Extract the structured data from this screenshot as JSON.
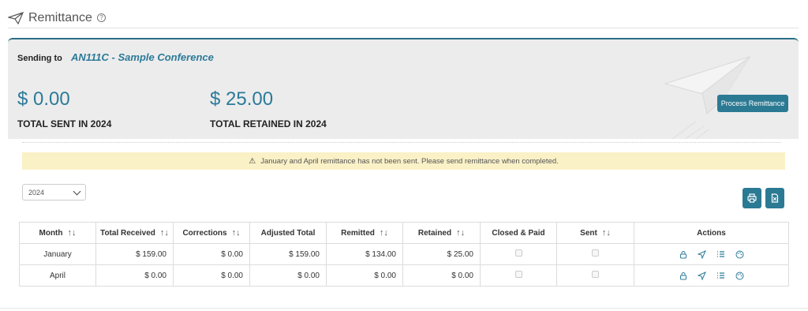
{
  "header": {
    "title": "Remittance",
    "help": "?"
  },
  "summary": {
    "sending_label": "Sending to",
    "sending_name": "AN111C - Sample Conference",
    "total_sent_amount": "$ 0.00",
    "total_sent_label": "TOTAL SENT IN 2024",
    "total_retained_amount": "$ 25.00",
    "total_retained_label": "TOTAL RETAINED IN 2024",
    "process_button": "Process Remittance"
  },
  "alert": {
    "icon": "warning-icon",
    "text": "January and April remittance has not been sent. Please send remittance when completed."
  },
  "filters": {
    "year": "2024"
  },
  "toolbar": {
    "print": "print-icon",
    "export": "export-icon"
  },
  "table": {
    "sort_glyph": "↑↓",
    "columns": [
      "Month",
      "Total Received",
      "Corrections",
      "Adjusted Total",
      "Remitted",
      "Retained",
      "Closed & Paid",
      "Sent",
      "Actions"
    ],
    "rows": [
      {
        "month": "January",
        "total_received": "$ 159.00",
        "corrections": "$ 0.00",
        "adjusted_total": "$ 159.00",
        "remitted": "$ 134.00",
        "retained": "$ 25.00"
      },
      {
        "month": "April",
        "total_received": "$ 0.00",
        "corrections": "$ 0.00",
        "adjusted_total": "$ 0.00",
        "remitted": "$ 0.00",
        "retained": "$ 0.00"
      }
    ]
  },
  "colors": {
    "accent": "#2b7a93",
    "alert_bg": "#fbf1c7",
    "panel_bg": "#ececec"
  }
}
